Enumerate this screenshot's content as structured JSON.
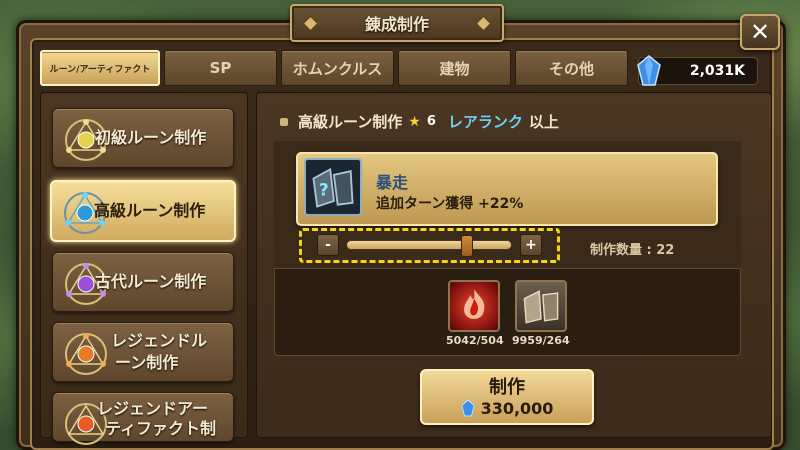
{
  "window": {
    "title": "錬成制作"
  },
  "close_button": {
    "label": "✕"
  },
  "tabs": [
    {
      "label": "ルーン/アーティファクト",
      "active": true
    },
    {
      "label": "SP",
      "active": false
    },
    {
      "label": "ホムンクルス",
      "active": false
    },
    {
      "label": "建物",
      "active": false
    },
    {
      "label": "その他",
      "active": false
    }
  ],
  "currency": {
    "crystals": "2,031K",
    "icon": "blue-crystal-icon"
  },
  "categories": [
    {
      "label": "初級ルーン制作",
      "icon": "rune-circle-gold-icon",
      "active": false
    },
    {
      "label": "高級ルーン制作",
      "icon": "rune-circle-blue-icon",
      "active": true
    },
    {
      "label": "古代ルーン制作",
      "icon": "rune-circle-purple-icon",
      "active": false
    },
    {
      "label": "レジェンドルーン制作",
      "line1": "レジェンドル",
      "line2": "ーン制作",
      "icon": "rune-circle-orange-icon",
      "active": false
    },
    {
      "label": "レジェンドアーティファクト制",
      "line1": "レジェンドアー",
      "line2": "ティファクト制",
      "icon": "rune-circle-orange-icon",
      "active": false
    }
  ],
  "heading": {
    "title": "高級ルーン制作",
    "star_count": "6",
    "rarity": "レアランク",
    "suffix": "以上"
  },
  "rune": {
    "name": "暴走",
    "effect": "追加ターン獲得 +22%",
    "icon": "unknown-rune-icon"
  },
  "quantity": {
    "label": "制作数量 : 22",
    "minus": "-",
    "plus": "+",
    "slider_fraction": 0.73
  },
  "materials": [
    {
      "icon": "fire-essence-icon",
      "count": "5042/504"
    },
    {
      "icon": "rune-stone-icon",
      "count": "9959/264"
    }
  ],
  "craft_button": {
    "label": "制作",
    "cost": "330,000",
    "cost_icon": "blue-crystal-icon"
  },
  "colors": {
    "highlight_outline": "#f0d60a",
    "rare_text": "#6fd3f5",
    "star": "#f7cf35"
  }
}
